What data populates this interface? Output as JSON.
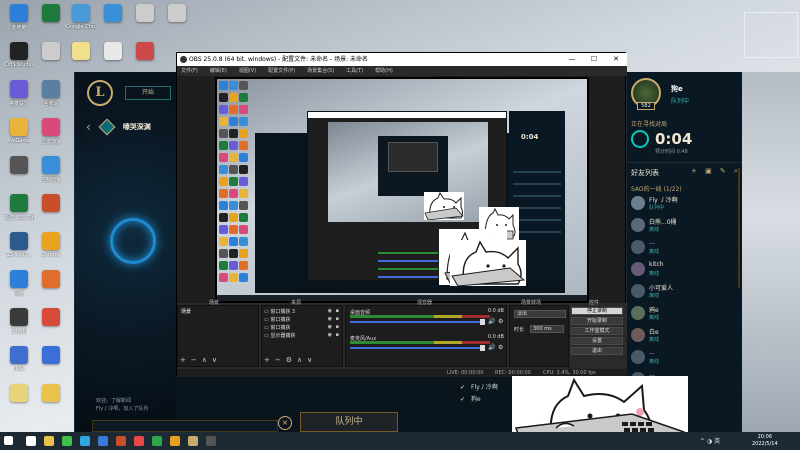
{
  "desktop": {
    "icons": [
      {
        "label": "此电脑",
        "color": "#2d7fd8"
      },
      {
        "label": "OBS Studio",
        "color": "#222222"
      },
      {
        "label": "英雄联盟",
        "color": "#6a5bd6"
      },
      {
        "label": "WeGame",
        "color": "#e8b33a"
      },
      {
        "label": "",
        "color": "#555555"
      },
      {
        "label": "新建 XLS 工作表",
        "color": "#1f7a3e"
      },
      {
        "label": "12-5 WT...",
        "color": "#2b5b8a"
      },
      {
        "label": "网络",
        "color": "#2d7fd8"
      },
      {
        "label": "Ctl心机",
        "color": "#3b3b3b"
      },
      {
        "label": "FLAC",
        "color": "#3f6ecf"
      },
      {
        "label": "",
        "color": "#e8d27a"
      },
      {
        "label": "",
        "color": "#1f7a3e"
      },
      {
        "label": "",
        "color": "#cccccc"
      },
      {
        "label": "回收站",
        "color": "#5a7fa0"
      },
      {
        "label": "迅雷加速",
        "color": "#d74a7a"
      },
      {
        "label": "控制面板",
        "color": "#3a8ed8"
      },
      {
        "label": "",
        "color": "#c94f2a"
      },
      {
        "label": "Chrome",
        "color": "#e8a21e"
      },
      {
        "label": "",
        "color": "#e06d2c"
      },
      {
        "label": "",
        "color": "#d84b3a"
      },
      {
        "label": "",
        "color": "#3a6fd8"
      },
      {
        "label": "",
        "color": "#e8c24a"
      },
      {
        "label": "Google Chrome",
        "color": "#4a9ad8"
      },
      {
        "label": "",
        "color": "#f0e08a"
      },
      {
        "label": "",
        "color": "#3a90d8"
      },
      {
        "label": "",
        "color": "#e8e8e8"
      },
      {
        "label": "",
        "color": "#cccccc"
      },
      {
        "label": "",
        "color": "#cc4a4a"
      },
      {
        "label": "",
        "color": "#cccccc"
      },
      {
        "label": "",
        "color": "#2fc34a"
      },
      {
        "label": "",
        "color": "#e8c24a"
      },
      {
        "label": "",
        "color": "#e8e8e8"
      },
      {
        "label": "",
        "color": "#cccccc"
      }
    ]
  },
  "lol_client": {
    "logo": "L",
    "play_button": "开始",
    "mode_title": "嚎哭深渊",
    "chat_lines": [
      "欢迎，了解新闻",
      "Fly丿冷啊，加入了队列"
    ],
    "queue_button": "队列中",
    "close_symbol": "×",
    "bottom_friends": [
      {
        "check": "✓",
        "name": "Fly丿冷啊"
      },
      {
        "check": "✓",
        "name": "狗e"
      }
    ]
  },
  "friends_panel": {
    "level": "582",
    "my_name": "狗e",
    "my_status": "队列中",
    "finding_title": "正在寻找对局",
    "timer": "0:04",
    "estimate": "预计时间 0:48",
    "list_title": "好友列表",
    "tool_icons": "+ ▣ ✎ ⌕",
    "group_name": "SAO的一线 (1/22)",
    "friends": [
      {
        "name": "Fly 丿冷啊",
        "status": "队列中",
        "color": "#6b7f8e"
      },
      {
        "name": "白熊...0桶",
        "status": "离线",
        "color": "#5c6a78"
      },
      {
        "name": "...",
        "status": "离线",
        "color": "#4b5a68"
      },
      {
        "name": "kitch",
        "status": "离线",
        "color": "#665a78"
      },
      {
        "name": "小可爱人",
        "status": "离线",
        "color": "#4b5a68"
      },
      {
        "name": "鸦e",
        "status": "离线",
        "color": "#5a6e5a"
      },
      {
        "name": "白e",
        "status": "离线",
        "color": "#6e5a5a"
      },
      {
        "name": "...",
        "status": "离线",
        "color": "#4b5a68"
      },
      {
        "name": "...",
        "status": "离线",
        "color": "#4b5a68"
      }
    ]
  },
  "obs": {
    "title": "OBS 25.0.8 (64 bit, windows) - 配置文件: 未命名 - 场景: 未命名",
    "window_controls": [
      "—",
      "☐",
      "✕"
    ],
    "menu": [
      "文件(F)",
      "编辑(E)",
      "视图(V)",
      "配置文件(P)",
      "场景集合(S)",
      "工具(T)",
      "帮助(H)"
    ],
    "docks": {
      "scenes": {
        "title": "场景",
        "items": [
          "场景"
        ]
      },
      "sources": {
        "title": "来源",
        "items": [
          "窗口捕获 3",
          "窗口捕获",
          "窗口捕获",
          "显示器捕获"
        ]
      },
      "mixer": {
        "title": "混音器",
        "channels": [
          {
            "name": "桌面音频",
            "db": "0.0 dB"
          },
          {
            "name": "麦克风/Aux",
            "db": "0.0 dB"
          }
        ]
      },
      "transitions": {
        "title": "场景转场",
        "type": "淡出",
        "duration_label": "时长",
        "duration_value": "300 ms"
      },
      "controls": {
        "title": "控件",
        "buttons": [
          "停止录制",
          "开始录制",
          "工作室模式",
          "设置",
          "退出"
        ]
      }
    },
    "tool_glyphs": [
      "+",
      "−",
      "∧",
      "∨"
    ],
    "status": {
      "live": "LIVE: 00:00:00",
      "rec": "REC: 00:00:00",
      "cpu": "CPU: 3.4%, 30.00 fps"
    }
  },
  "taskbar": {
    "icons": [
      "#ffffff",
      "#e8c24a",
      "#3ec14a",
      "#2fa8e0",
      "#3a7ad8",
      "#c94f2a",
      "#e84a4a",
      "#2fa84a",
      "#e8a21e",
      "#c8aa6e",
      "#555555"
    ],
    "tray": "^ ◑ 英",
    "time": "20:06",
    "date": "2022/5/14"
  }
}
